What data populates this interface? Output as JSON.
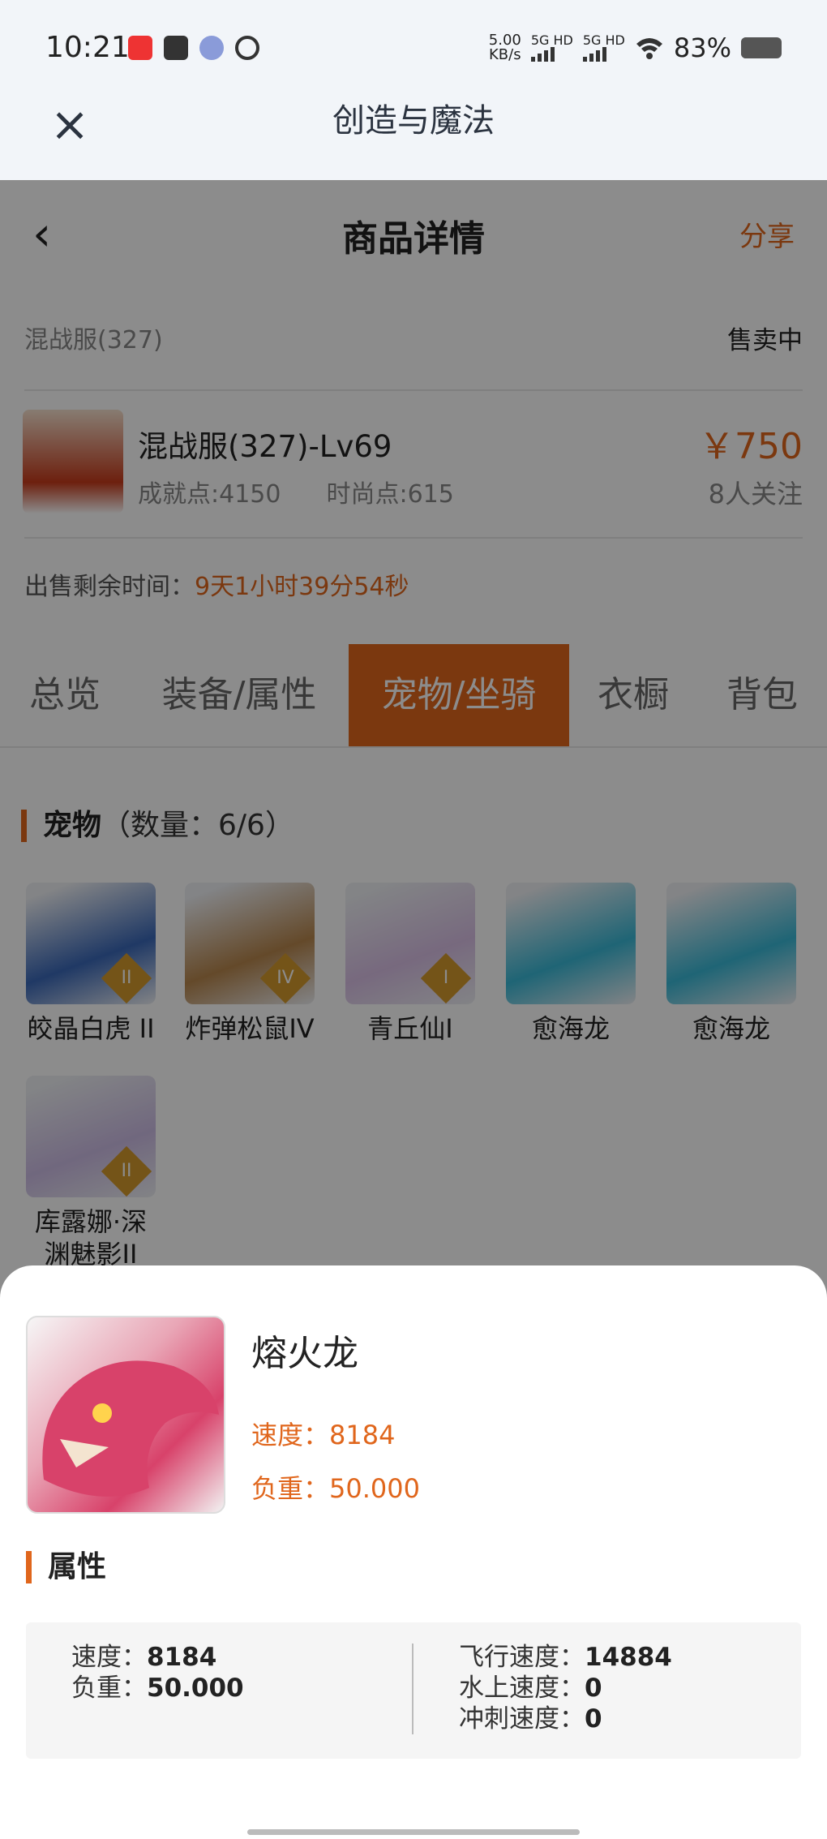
{
  "status_bar": {
    "time": "10:21",
    "net_speed": "5.00",
    "net_unit": "KB/s",
    "sim1": "5G HD",
    "sim2": "5G HD",
    "battery": "83%",
    "battery_level": 0.83,
    "notification_icons": [
      "redbook-icon",
      "mail-icon",
      "cloud-icon",
      "link-icon"
    ]
  },
  "app_bar": {
    "title": "创造与魔法",
    "close_icon": "close-icon"
  },
  "page": {
    "title": "商品详情",
    "back_icon": "chevron-left-icon",
    "share": "分享",
    "server": "混战服(327)",
    "status": "售卖中",
    "character": {
      "name": "混战服(327)-Lv69",
      "achievement": "成就点:4150",
      "fashion": "时尚点:615",
      "price": "￥750",
      "followers": "8人关注"
    },
    "remaining_label": "出售剩余时间：",
    "remaining_value": "9天1小时39分54秒"
  },
  "tabs": [
    "总览",
    "装备/属性",
    "宠物/坐骑",
    "衣橱",
    "背包"
  ],
  "active_tab": 2,
  "pets_section": {
    "title": "宠物",
    "count": "（数量：6/6）",
    "items": [
      {
        "name": "皎晶白虎 II",
        "badge": "II",
        "color": "#3a68b8"
      },
      {
        "name": "炸弹松鼠IV",
        "badge": "IV",
        "color": "#b7864d"
      },
      {
        "name": "青丘仙I",
        "badge": "I",
        "color": "#d9c0e6"
      },
      {
        "name": "愈海龙",
        "badge": "",
        "color": "#39b8d6"
      },
      {
        "name": "愈海龙",
        "badge": "",
        "color": "#39b8d6"
      },
      {
        "name": "库露娜·深渊魅影II",
        "badge": "II",
        "color": "#cdbde6"
      }
    ]
  },
  "detail_sheet": {
    "name": "熔火龙",
    "speed": "速度：8184",
    "load": "负重：50.000",
    "attr_title": "属性",
    "attrs_left": [
      {
        "label": "速度：",
        "value": "8184"
      },
      {
        "label": "负重：",
        "value": "50.000"
      }
    ],
    "attrs_right": [
      {
        "label": "飞行速度：",
        "value": "14884"
      },
      {
        "label": "水上速度：",
        "value": "0"
      },
      {
        "label": "冲刺速度：",
        "value": "0"
      }
    ]
  }
}
